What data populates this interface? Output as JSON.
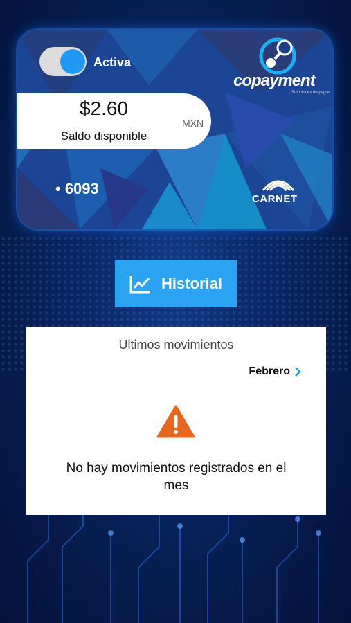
{
  "card": {
    "status_label": "Activa",
    "status_active": true,
    "brand_name": "copayment",
    "brand_tagline": "Soluciones de pagos",
    "balance": "$2.60",
    "balance_label": "Saldo disponible",
    "currency": "MXN",
    "card_number": "• 6093",
    "network": "CARNET",
    "icons": {
      "toggle": "toggle-switch",
      "brand": "copayment-logo-icon",
      "network": "carnet-logo-icon"
    }
  },
  "history_button": {
    "label": "Historial",
    "icon": "chart-line-icon",
    "color": "#2aa3f3"
  },
  "movements": {
    "title": "Ultimos movimientos",
    "month": "Febrero",
    "month_icon": "chevron-right-icon",
    "empty_icon": "warning-icon",
    "empty_message": "No hay movimientos registrados en el mes",
    "accent_color": "#e8671c"
  }
}
